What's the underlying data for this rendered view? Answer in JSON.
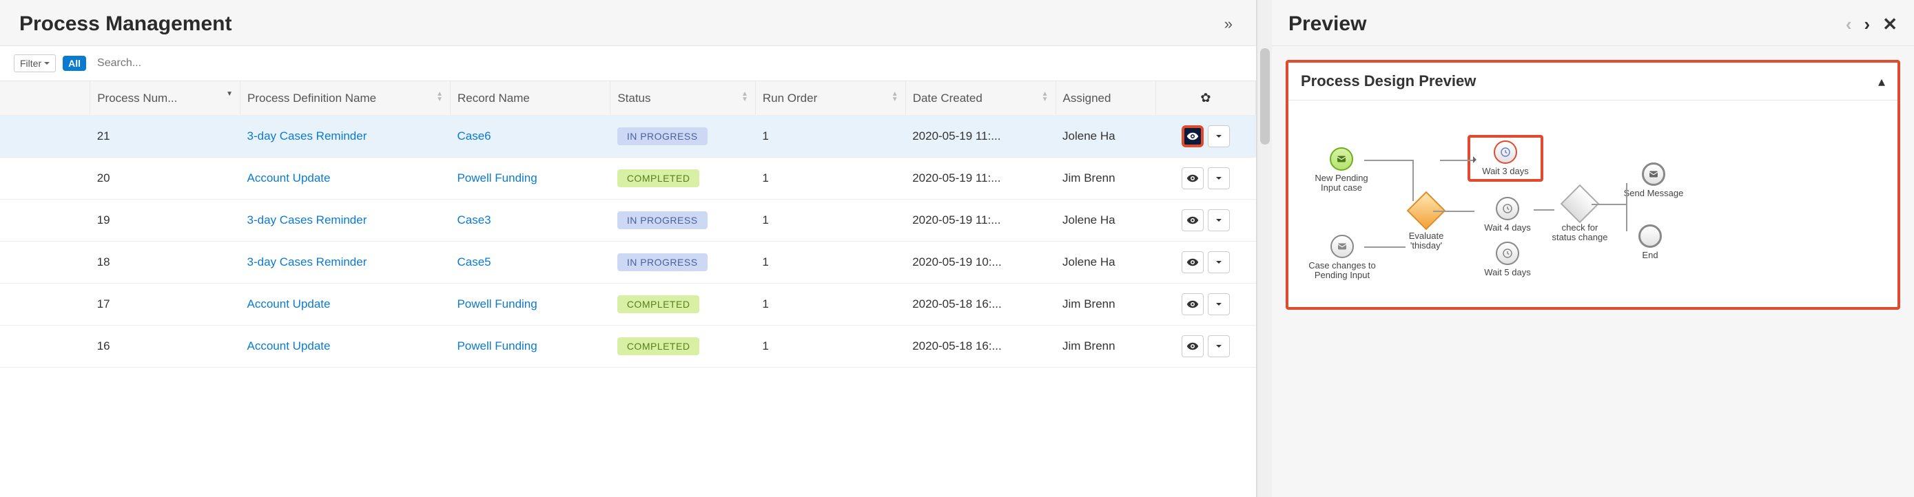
{
  "header": {
    "title": "Process Management"
  },
  "filter": {
    "label": "Filter",
    "tag": "All",
    "search_placeholder": "Search..."
  },
  "columns": {
    "process_num": "Process Num...",
    "pdname": "Process Definition Name",
    "record": "Record Name",
    "status": "Status",
    "runorder": "Run Order",
    "datec": "Date Created",
    "assigned": "Assigned"
  },
  "rows": [
    {
      "num": "21",
      "pdname": "3-day Cases Reminder",
      "record": "Case6",
      "status": "IN PROGRESS",
      "status_kind": "inprogress",
      "run": "1",
      "date": "2020-05-19 11:...",
      "assigned": "Jolene Ha",
      "selected": true
    },
    {
      "num": "20",
      "pdname": "Account Update",
      "record": "Powell Funding",
      "status": "COMPLETED",
      "status_kind": "completed",
      "run": "1",
      "date": "2020-05-19 11:...",
      "assigned": "Jim Brenn",
      "selected": false
    },
    {
      "num": "19",
      "pdname": "3-day Cases Reminder",
      "record": "Case3",
      "status": "IN PROGRESS",
      "status_kind": "inprogress",
      "run": "1",
      "date": "2020-05-19 11:...",
      "assigned": "Jolene Ha",
      "selected": false
    },
    {
      "num": "18",
      "pdname": "3-day Cases Reminder",
      "record": "Case5",
      "status": "IN PROGRESS",
      "status_kind": "inprogress",
      "run": "1",
      "date": "2020-05-19 10:...",
      "assigned": "Jolene Ha",
      "selected": false
    },
    {
      "num": "17",
      "pdname": "Account Update",
      "record": "Powell Funding",
      "status": "COMPLETED",
      "status_kind": "completed",
      "run": "1",
      "date": "2020-05-18 16:...",
      "assigned": "Jim Brenn",
      "selected": false
    },
    {
      "num": "16",
      "pdname": "Account Update",
      "record": "Powell Funding",
      "status": "COMPLETED",
      "status_kind": "completed",
      "run": "1",
      "date": "2020-05-18 16:...",
      "assigned": "Jim Brenn",
      "selected": false
    }
  ],
  "preview": {
    "title": "Preview",
    "panel_title": "Process Design Preview",
    "nodes": {
      "start": "New Pending Input case",
      "case_changes": "Case changes to Pending Input",
      "evaluate": "Evaluate 'thisday'",
      "wait3": "Wait 3 days",
      "wait4": "Wait 4 days",
      "wait5": "Wait 5 days",
      "check": "check for status change",
      "send": "Send Message",
      "end": "End"
    }
  }
}
